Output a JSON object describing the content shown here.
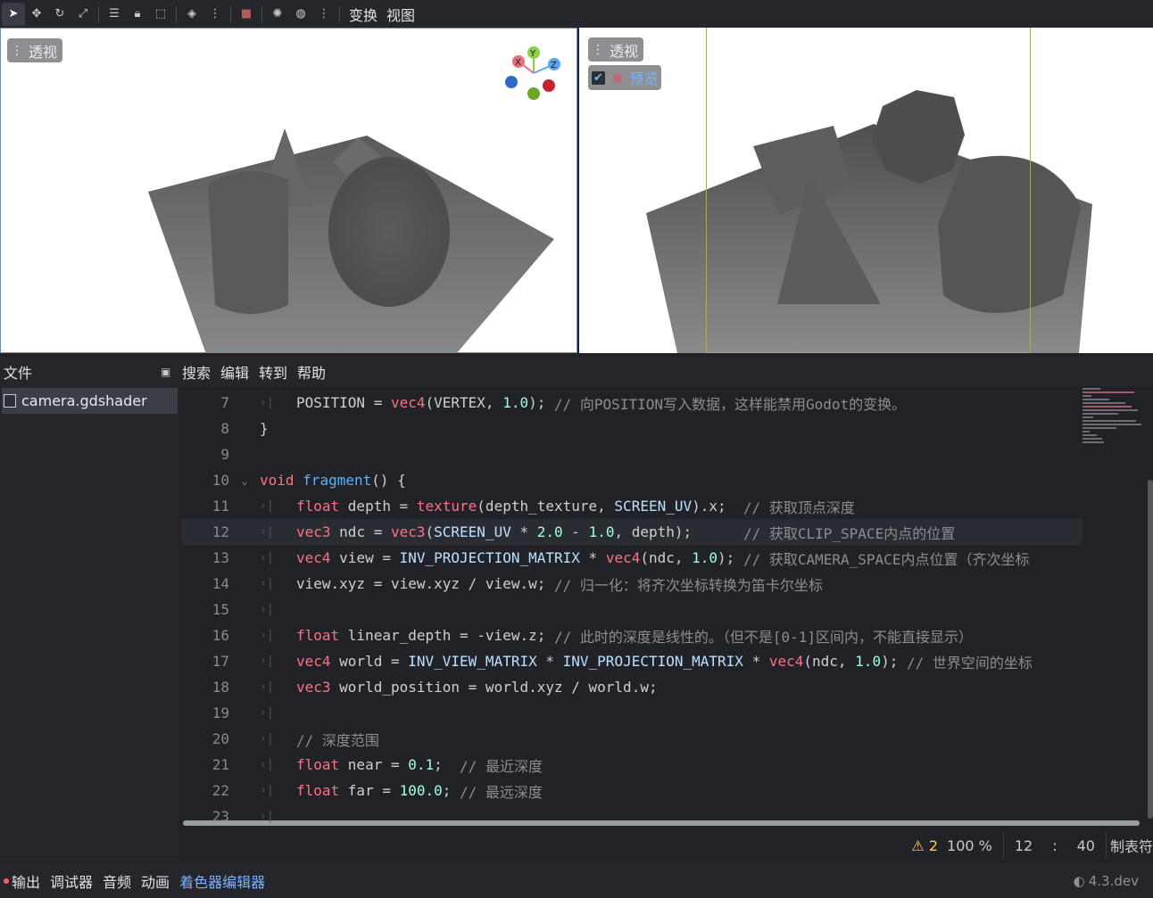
{
  "toolbar": {
    "tools": [
      "select-icon",
      "move-icon",
      "rotate-icon",
      "scale-icon",
      "list-select-icon",
      "lock-icon",
      "group-icon",
      "cube-icon",
      "snap-icon",
      "camera-icon",
      "sun-icon",
      "globe-icon",
      "more-icon"
    ],
    "menu_transform": "变换",
    "menu_view": "视图"
  },
  "viewport_left": {
    "label": "透视",
    "gizmo": {
      "x": "X",
      "y": "Y",
      "z": "Z"
    }
  },
  "viewport_right": {
    "label": "透视",
    "preview_label": "预览",
    "preview_checked": true
  },
  "menubar": {
    "file": "文件",
    "items": [
      "搜索",
      "编辑",
      "转到",
      "帮助"
    ]
  },
  "sidebar": {
    "files": [
      "camera.gdshader"
    ]
  },
  "editor": {
    "lines": [
      {
        "n": "7",
        "tabs": 1
      },
      {
        "n": "8",
        "tabs": 0
      },
      {
        "n": "9",
        "tabs": 0
      },
      {
        "n": "10",
        "tabs": 0
      },
      {
        "n": "11",
        "tabs": 1
      },
      {
        "n": "12",
        "tabs": 1
      },
      {
        "n": "13",
        "tabs": 1
      },
      {
        "n": "14",
        "tabs": 1
      },
      {
        "n": "15",
        "tabs": 1
      },
      {
        "n": "16",
        "tabs": 1
      },
      {
        "n": "17",
        "tabs": 1
      },
      {
        "n": "18",
        "tabs": 1
      },
      {
        "n": "19",
        "tabs": 1
      },
      {
        "n": "20",
        "tabs": 1
      },
      {
        "n": "21",
        "tabs": 1
      },
      {
        "n": "22",
        "tabs": 1
      },
      {
        "n": "23",
        "tabs": 1
      }
    ],
    "code": {
      "l7": [
        [
          "code",
          "POSITION = "
        ],
        [
          "fn2",
          "vec4"
        ],
        [
          "code",
          "(VERTEX, "
        ],
        [
          "num",
          "1.0"
        ],
        [
          "code",
          "); "
        ],
        [
          "cmt",
          "// 向POSITION写入数据，这样能禁用Godot的变换。"
        ]
      ],
      "l8": [
        [
          "code",
          "}"
        ]
      ],
      "l9": [],
      "l10": [
        [
          "kw",
          "void "
        ],
        [
          "fn",
          "fragment"
        ],
        [
          "code",
          "() {"
        ]
      ],
      "l11": [
        [
          "kw",
          "float "
        ],
        [
          "code",
          "depth = "
        ],
        [
          "kw2",
          "texture"
        ],
        [
          "code",
          "(depth_texture, "
        ],
        [
          "cst",
          "SCREEN_UV"
        ],
        [
          "code",
          ").x;  "
        ],
        [
          "cmt",
          "// 获取顶点深度"
        ]
      ],
      "l12": [
        [
          "kw",
          "vec3 "
        ],
        [
          "code",
          "ndc = "
        ],
        [
          "kw2",
          "vec3"
        ],
        [
          "code",
          "("
        ],
        [
          "cst",
          "SCREEN_UV"
        ],
        [
          "code",
          " * "
        ],
        [
          "num",
          "2.0"
        ],
        [
          "code",
          " - "
        ],
        [
          "num",
          "1.0"
        ],
        [
          "code",
          ", depth);      "
        ],
        [
          "cmt",
          "// 获取CLIP_SPACE内点的位置"
        ]
      ],
      "l13": [
        [
          "kw",
          "vec4 "
        ],
        [
          "code",
          "view = "
        ],
        [
          "cst",
          "INV_PROJECTION_MATRIX"
        ],
        [
          "code",
          " * "
        ],
        [
          "kw2",
          "vec4"
        ],
        [
          "code",
          "(ndc, "
        ],
        [
          "num",
          "1.0"
        ],
        [
          "code",
          "); "
        ],
        [
          "cmt",
          "// 获取CAMERA_SPACE内点位置（齐次坐标"
        ]
      ],
      "l14": [
        [
          "code",
          "view.xyz = view.xyz / view.w; "
        ],
        [
          "cmt",
          "// 归一化：将齐次坐标转换为笛卡尔坐标"
        ]
      ],
      "l15": [],
      "l16": [
        [
          "kw",
          "float "
        ],
        [
          "code",
          "linear_depth = -view.z; "
        ],
        [
          "cmt",
          "// 此时的深度是线性的。（但不是[0-1]区间内，不能直接显示）"
        ]
      ],
      "l17": [
        [
          "kw",
          "vec4 "
        ],
        [
          "code",
          "world = "
        ],
        [
          "cst",
          "INV_VIEW_MATRIX"
        ],
        [
          "code",
          " * "
        ],
        [
          "cst",
          "INV_PROJECTION_MATRIX"
        ],
        [
          "code",
          " * "
        ],
        [
          "kw2",
          "vec4"
        ],
        [
          "code",
          "(ndc, "
        ],
        [
          "num",
          "1.0"
        ],
        [
          "code",
          "); "
        ],
        [
          "cmt",
          "// 世界空间的坐标"
        ]
      ],
      "l18": [
        [
          "kw",
          "vec3 "
        ],
        [
          "code",
          "world_position = world.xyz / world.w;"
        ]
      ],
      "l19": [],
      "l20": [
        [
          "cmt",
          "// 深度范围"
        ]
      ],
      "l21": [
        [
          "kw",
          "float "
        ],
        [
          "code",
          "near = "
        ],
        [
          "num",
          "0.1"
        ],
        [
          "code",
          ";  "
        ],
        [
          "cmt",
          "// 最近深度"
        ]
      ],
      "l22": [
        [
          "kw",
          "float "
        ],
        [
          "code",
          "far = "
        ],
        [
          "num",
          "100.0"
        ],
        [
          "code",
          "; "
        ],
        [
          "cmt",
          "// 最远深度"
        ]
      ],
      "l23": []
    },
    "current_line": "12"
  },
  "status": {
    "warnings": "2",
    "zoom": "100 %",
    "line": "12",
    "colon": ":",
    "column": "40",
    "indent": "制表符"
  },
  "bottom": {
    "tabs": [
      "输出",
      "调试器",
      "音频",
      "动画",
      "着色器编辑器"
    ],
    "selected": "着色器编辑器",
    "version": "4.3.dev"
  },
  "colors": {
    "accent": "#7ab3ff",
    "keyword": "#ff7085",
    "number": "#a1ffe0",
    "comment": "#8a8d93",
    "warning": "#ffd24a"
  }
}
